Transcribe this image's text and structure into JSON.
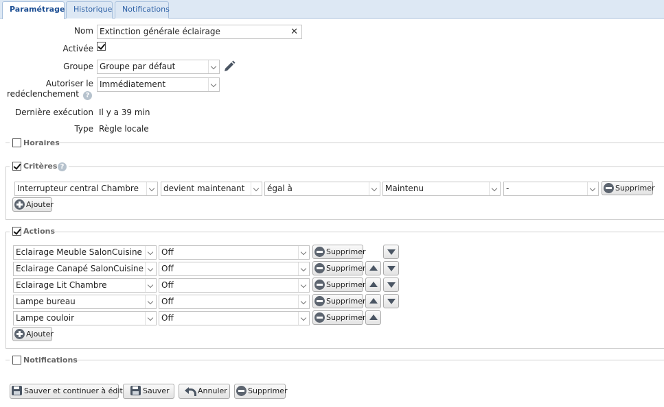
{
  "tabs": [
    {
      "label": "Paramétrage",
      "active": true
    },
    {
      "label": "Historique",
      "active": false
    },
    {
      "label": "Notifications",
      "active": false
    }
  ],
  "form": {
    "nom_label": "Nom",
    "nom_value": "Extinction générale éclairage",
    "activee_label": "Activée",
    "activee_checked": true,
    "groupe_label": "Groupe",
    "groupe_value": "Groupe par défaut",
    "redecl_label_1": "Autoriser le",
    "redecl_label_2": "redéclenchement",
    "redecl_value": "Immédiatement",
    "derniere_label": "Dernière exécution",
    "derniere_value": "Il y a 39 min",
    "type_label": "Type",
    "type_value": "Règle locale"
  },
  "sections": {
    "horaires": {
      "label": "Horaires",
      "checked": false
    },
    "criteres": {
      "label": "Critères",
      "checked": true
    },
    "actions": {
      "label": "Actions",
      "checked": true
    },
    "notifications": {
      "label": "Notifications",
      "checked": false
    }
  },
  "criteria": [
    {
      "device": "Interrupteur central Chambre",
      "event": "devient maintenant",
      "operator": "égal à",
      "value": "Maintenu",
      "extra": "-"
    }
  ],
  "actions": [
    {
      "device": "Eclairage Meuble SalonCuisine",
      "value": "Off"
    },
    {
      "device": "Eclairage Canapé SalonCuisine",
      "value": "Off"
    },
    {
      "device": "Eclairage Lit Chambre",
      "value": "Off"
    },
    {
      "device": "Lampe bureau",
      "value": "Off"
    },
    {
      "device": "Lampe couloir",
      "value": "Off"
    }
  ],
  "labels": {
    "supprimer": "Supprimer",
    "ajouter": "Ajouter",
    "help": "?"
  },
  "footer": {
    "save_continue": "Sauver et continuer à éditer",
    "save": "Sauver",
    "cancel": "Annuler",
    "delete": "Supprimer"
  },
  "colors": {
    "tab_bg": "#dde8f4",
    "tab_text": "#2b5fa5",
    "border": "#c4c4c4"
  }
}
